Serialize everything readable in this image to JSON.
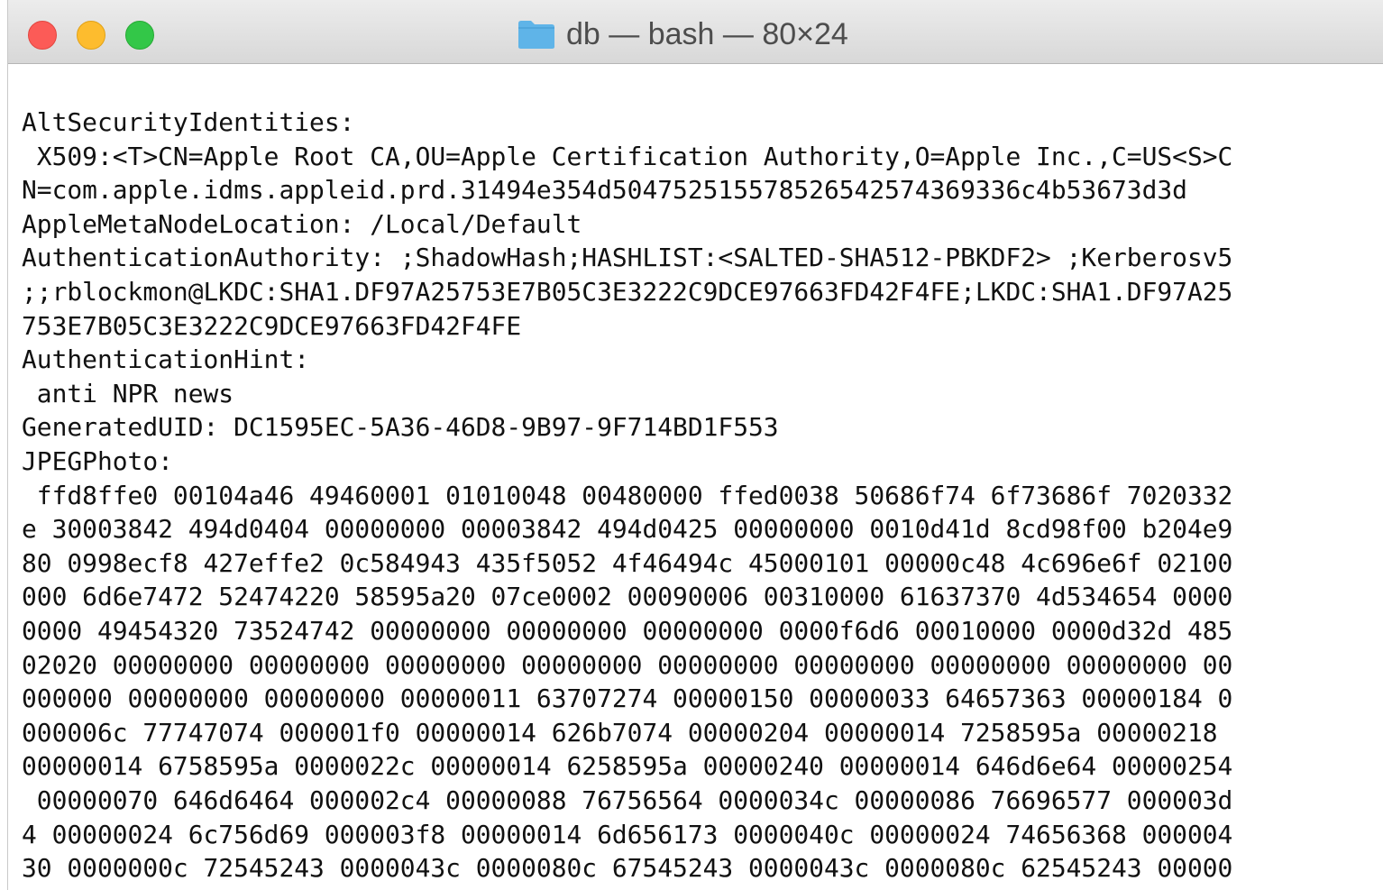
{
  "window": {
    "title": "db — bash — 80×24"
  },
  "icons": {
    "folder": "folder-icon",
    "close": "close-button",
    "minimize": "minimize-button",
    "zoom": "zoom-button"
  },
  "colors": {
    "close": "#fc5b57",
    "minimize": "#fdbc2e",
    "zoom": "#33c748",
    "folder": "#5fb4e8"
  },
  "terminal": {
    "lines": [
      "AltSecurityIdentities:",
      " X509:<T>CN=Apple Root CA,OU=Apple Certification Authority,O=Apple Inc.,C=US<S>C",
      "N=com.apple.idms.appleid.prd.31494e354d504752515578526542574369336c4b53673d3d",
      "AppleMetaNodeLocation: /Local/Default",
      "AuthenticationAuthority: ;ShadowHash;HASHLIST:<SALTED-SHA512-PBKDF2> ;Kerberosv5",
      ";;rblockmon@LKDC:SHA1.DF97A25753E7B05C3E3222C9DCE97663FD42F4FE;LKDC:SHA1.DF97A25",
      "753E7B05C3E3222C9DCE97663FD42F4FE",
      "AuthenticationHint:",
      " anti NPR news",
      "GeneratedUID: DC1595EC-5A36-46D8-9B97-9F714BD1F553",
      "JPEGPhoto:",
      " ffd8ffe0 00104a46 49460001 01010048 00480000 ffed0038 50686f74 6f73686f 7020332",
      "e 30003842 494d0404 00000000 00003842 494d0425 00000000 0010d41d 8cd98f00 b204e9",
      "80 0998ecf8 427effe2 0c584943 435f5052 4f46494c 45000101 00000c48 4c696e6f 02100",
      "000 6d6e7472 52474220 58595a20 07ce0002 00090006 00310000 61637370 4d534654 0000",
      "0000 49454320 73524742 00000000 00000000 00000000 0000f6d6 00010000 0000d32d 485",
      "02020 00000000 00000000 00000000 00000000 00000000 00000000 00000000 00000000 00",
      "000000 00000000 00000000 00000011 63707274 00000150 00000033 64657363 00000184 0",
      "000006c 77747074 000001f0 00000014 626b7074 00000204 00000014 7258595a 00000218",
      "00000014 6758595a 0000022c 00000014 6258595a 00000240 00000014 646d6e64 00000254",
      " 00000070 646d6464 000002c4 00000088 76756564 0000034c 00000086 76696577 000003d",
      "4 00000024 6c756d69 000003f8 00000014 6d656173 0000040c 00000024 74656368 000004",
      "30 0000000c 72545243 0000043c 0000080c 67545243 0000043c 0000080c 62545243 00000"
    ]
  }
}
